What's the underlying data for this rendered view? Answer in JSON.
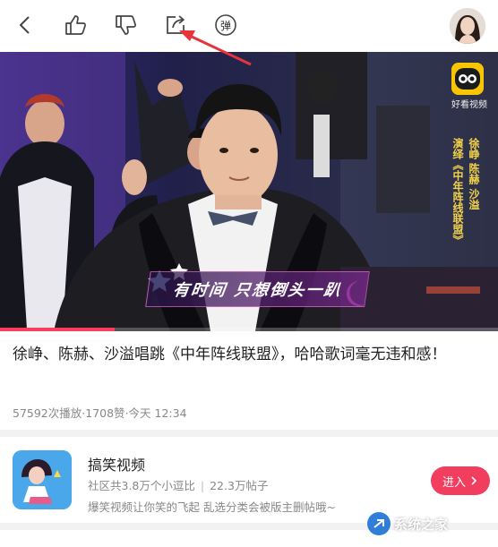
{
  "toolbar": {
    "back_icon": "back-icon",
    "like_icon": "thumbs-up-icon",
    "dislike_icon": "thumbs-down-icon",
    "share_icon": "share-icon",
    "danmaku_label": "弹",
    "avatar_icon": "user-avatar"
  },
  "video": {
    "logo_text": "好看视频",
    "credit_artists": "徐峥 陈赫 沙溢",
    "credit_song": "演绎《中年阵线联盟》",
    "subtitle": "有时间 只想倒头一趴",
    "progress": 0.23
  },
  "info": {
    "title": "徐峥、陈赫、沙溢唱跳《中年阵线联盟》，哈哈歌词毫无违和感！",
    "plays": "57592次播放",
    "likes": "1708赞",
    "time": "今天 12:34"
  },
  "channel": {
    "name": "搞笑视频",
    "community": "社区共3.8万个小逗比",
    "posts": "22.3万帖子",
    "description": "爆笑视频让你笑的飞起  乱选分类会被版主删帖哦~",
    "enter_label": "进入"
  },
  "watermark": {
    "text": "系统之家"
  },
  "colors": {
    "accent": "#f13d5e",
    "annotation": "#e8323c",
    "logo_yellow": "#f7c600"
  }
}
